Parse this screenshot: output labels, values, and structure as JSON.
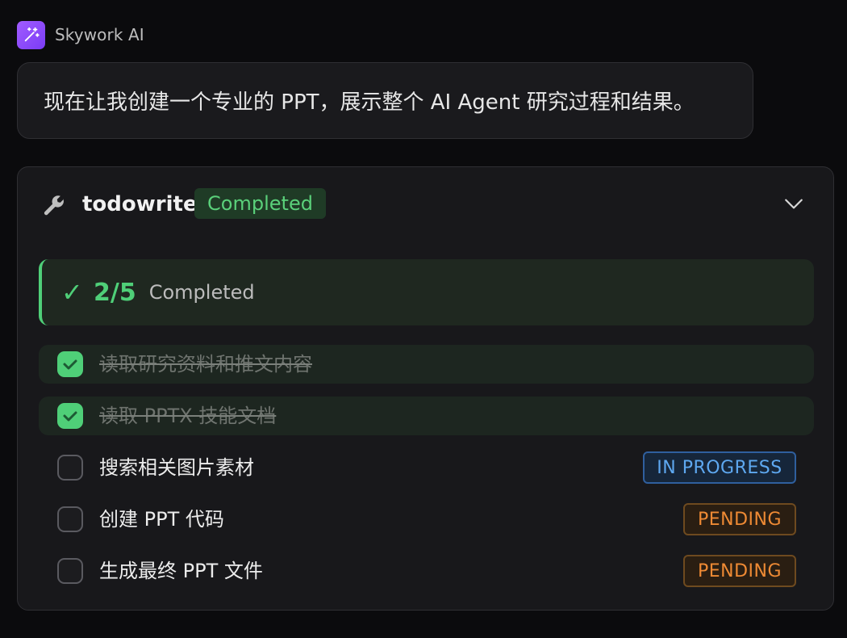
{
  "header": {
    "app_name": "Skywork AI",
    "logo_icon": "magic-wand-icon"
  },
  "message": {
    "text": "现在让我创建一个专业的 PPT，展示整个 AI Agent 研究过程和结果。"
  },
  "tool": {
    "icon": "wrench-icon",
    "name": "todowrite",
    "status": "Completed",
    "status_color": "#5ad07a",
    "toggle_icon": "chevron-down-icon"
  },
  "summary": {
    "check": "✓",
    "count": "2/5",
    "label": "Completed",
    "accent": "#4fcf78"
  },
  "tasks": [
    {
      "label": "读取研究资料和推文内容",
      "done": true,
      "badge": ""
    },
    {
      "label": "读取 PPTX 技能文档",
      "done": true,
      "badge": ""
    },
    {
      "label": "搜索相关图片素材",
      "done": false,
      "badge": "IN PROGRESS"
    },
    {
      "label": "创建 PPT 代码",
      "done": false,
      "badge": "PENDING"
    },
    {
      "label": "生成最终 PPT 文件",
      "done": false,
      "badge": "PENDING"
    }
  ],
  "colors": {
    "in_progress": "#5ea8f0",
    "pending": "#ee8a34"
  }
}
